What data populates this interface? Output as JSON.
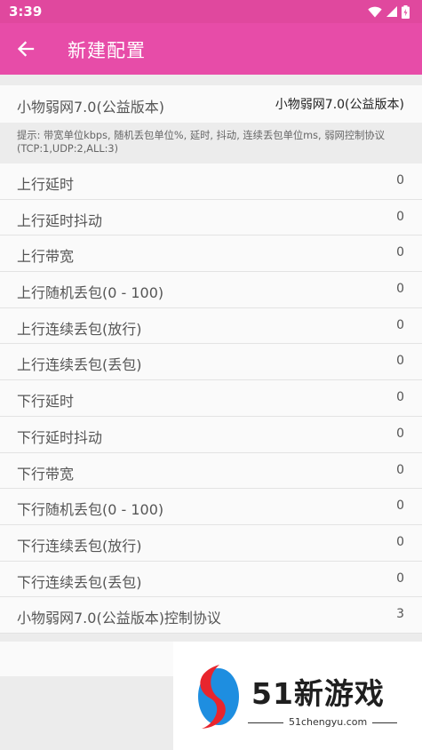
{
  "status_bar": {
    "time": "3:39"
  },
  "app_bar": {
    "title": "新建配置"
  },
  "config": {
    "label": "小物弱网7.0(公益版本)",
    "value": "小物弱网7.0(公益版本)"
  },
  "hint": "提示: 带宽单位kbps, 随机丢包单位%, 延时, 抖动, 连续丢包单位ms, 弱网控制协议(TCP:1,UDP:2,ALL:3)",
  "rows": [
    {
      "label": "上行延时",
      "value": "0"
    },
    {
      "label": "上行延时抖动",
      "value": "0"
    },
    {
      "label": "上行带宽",
      "value": "0"
    },
    {
      "label": "上行随机丢包(0 - 100)",
      "value": "0"
    },
    {
      "label": "上行连续丢包(放行)",
      "value": "0"
    },
    {
      "label": "上行连续丢包(丢包)",
      "value": "0"
    },
    {
      "label": "下行延时",
      "value": "0"
    },
    {
      "label": "下行延时抖动",
      "value": "0"
    },
    {
      "label": "下行带宽",
      "value": "0"
    },
    {
      "label": "下行随机丢包(0 - 100)",
      "value": "0"
    },
    {
      "label": "下行连续丢包(放行)",
      "value": "0"
    },
    {
      "label": "下行连续丢包(丢包)",
      "value": "0"
    },
    {
      "label": "小物弱网7.0(公益版本)控制协议",
      "value": "3"
    }
  ],
  "watermark": {
    "text": "51新游戏",
    "sub": "51chengyu.com"
  },
  "colors": {
    "status_bar": "#e0489e",
    "app_bar": "#e74ca8",
    "accent_red": "#e8252d",
    "accent_blue": "#1e8ee0"
  }
}
